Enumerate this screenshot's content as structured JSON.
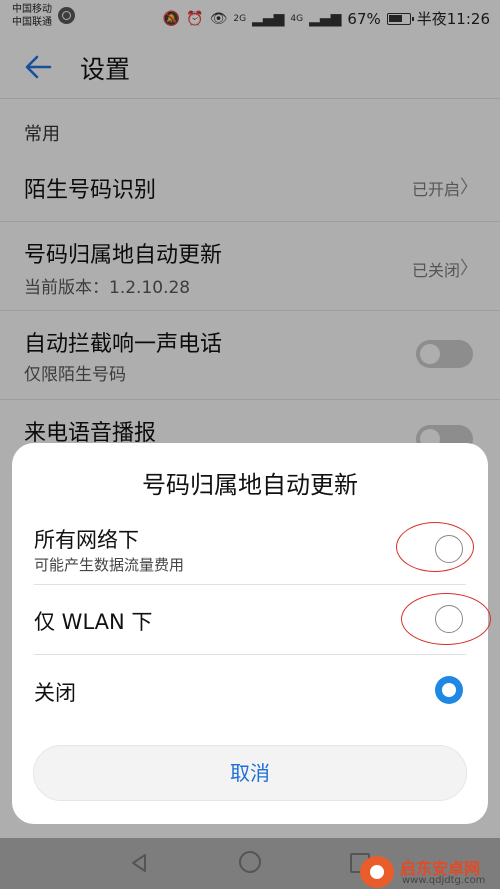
{
  "status_bar": {
    "carrier_1": "中国移动",
    "carrier_2": "中国联通",
    "battery": "67%",
    "time": "半夜11:26",
    "network_1": "2G",
    "network_2": "4G"
  },
  "header": {
    "title": "设置"
  },
  "section": {
    "title": "常用"
  },
  "items": [
    {
      "label": "陌生号码识别",
      "value": "已开启"
    },
    {
      "label": "号码归属地自动更新",
      "sub": "当前版本：1.2.10.28",
      "value": "已关闭"
    },
    {
      "label": "自动拦截响一声电话",
      "sub": "仅限陌生号码",
      "toggle": false
    },
    {
      "label": "来电语音播报",
      "toggle": false
    }
  ],
  "dialog": {
    "title": "号码归属地自动更新",
    "options": [
      {
        "label": "所有网络下",
        "sub": "可能产生数据流量费用",
        "selected": false
      },
      {
        "label": "仅 WLAN 下",
        "selected": false
      },
      {
        "label": "关闭",
        "selected": true
      }
    ],
    "cancel_label": "取消"
  },
  "watermark": {
    "title": "启东安卓网",
    "url": "www.qdjdtg.com"
  },
  "colors": {
    "accent": "#1e88e5",
    "annotation": "#d9302c"
  },
  "icons": [
    "back-arrow-icon",
    "chevron-right-icon",
    "nav-back-icon",
    "nav-home-icon",
    "nav-recent-icon"
  ]
}
